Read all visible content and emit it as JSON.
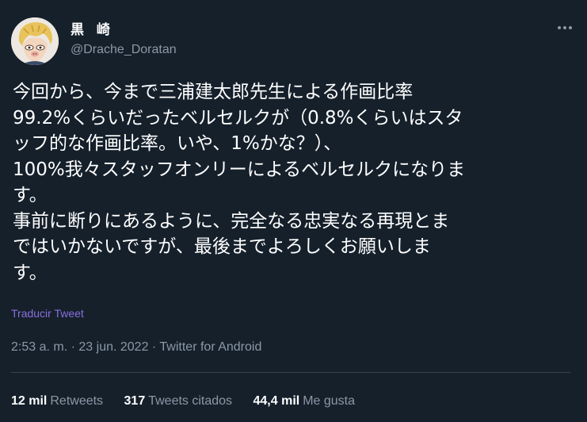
{
  "user": {
    "display_name": "黒 崎",
    "handle": "@Drache_Doratan"
  },
  "icons": {
    "more": "more-horizontal-icon"
  },
  "tweet": {
    "lines": [
      "今回から、今まで三浦建太郎先生による作画比率",
      "99.2%くらいだったベルセルクが（0.8%くらいはスタ",
      "ッフ的な作画比率。いや、1%かな？）、",
      "100%我々スタッフオンリーによるベルセルクになりま",
      "す。",
      "事前に断りにあるように、完全なる忠実なる再現とま",
      "ではいかないですが、最後までよろしくお願いしま",
      "す。"
    ],
    "translate_label": "Traducir Tweet",
    "time": "2:53 a. m.",
    "date": "23 jun. 2022",
    "source": "Twitter for Android",
    "separator": "·"
  },
  "stats": [
    {
      "value": "12 mil",
      "label": "Retweets"
    },
    {
      "value": "317",
      "label": "Tweets citados"
    },
    {
      "value": "44,4 mil",
      "label": "Me gusta"
    }
  ],
  "colors": {
    "background": "#15202b",
    "text": "#ffffff",
    "muted": "#8b98a5",
    "link": "#8a6fdf",
    "divider": "#38444d"
  }
}
